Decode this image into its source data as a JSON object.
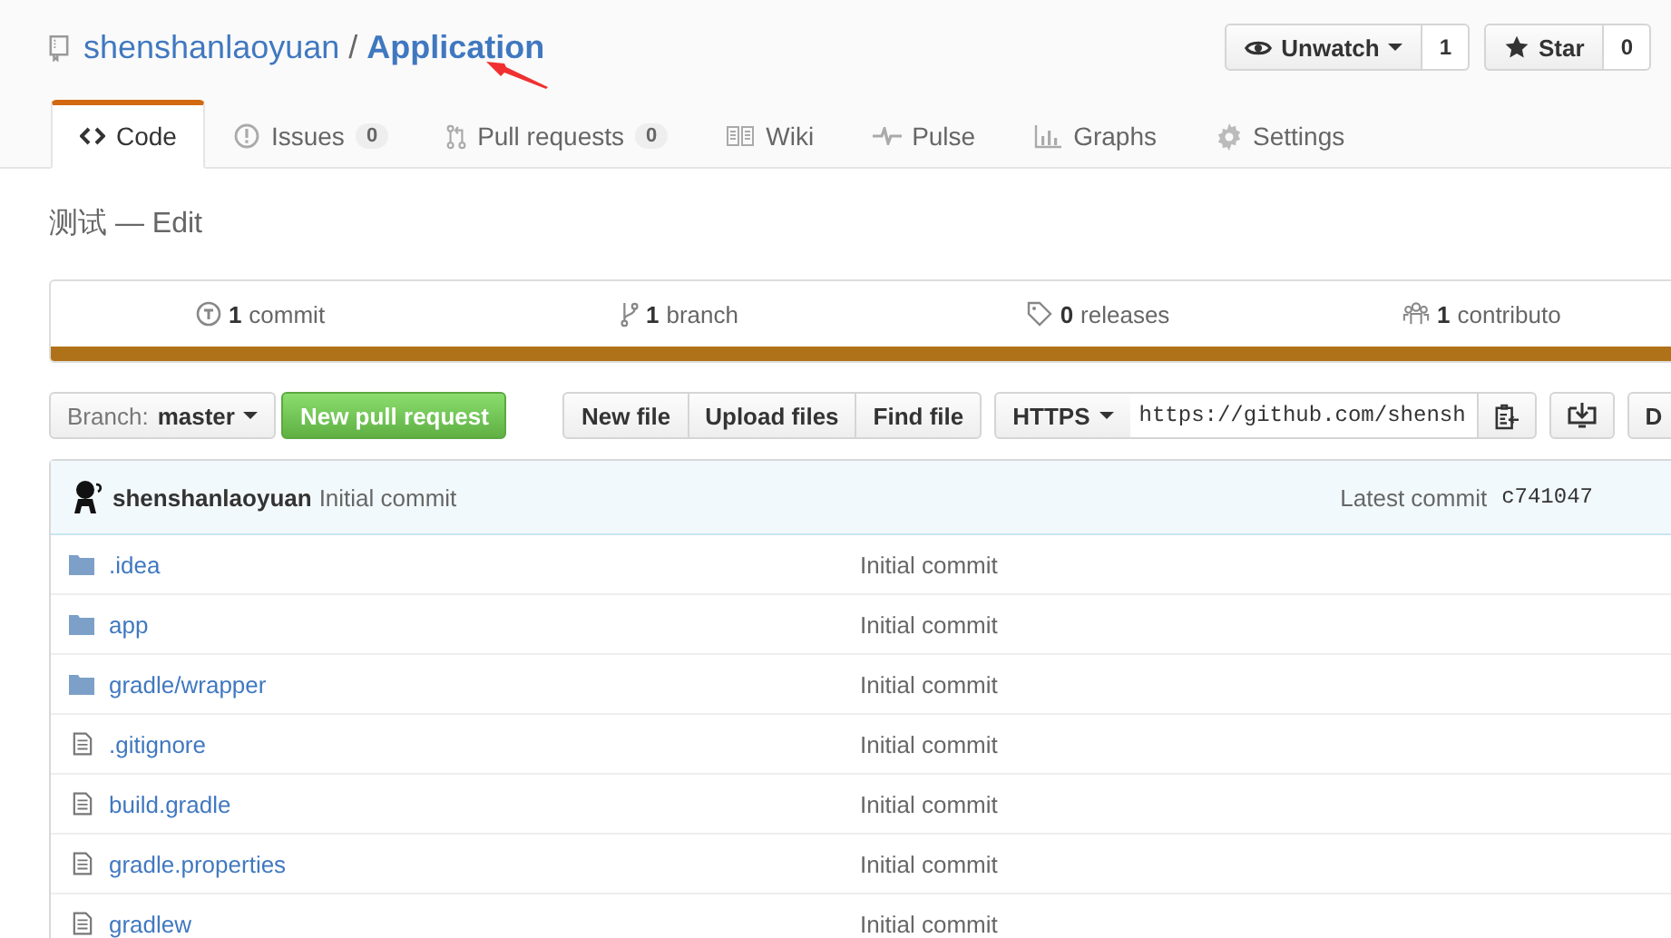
{
  "repo": {
    "owner": "shenshanlaoyuan",
    "separator": "/",
    "name": "Application"
  },
  "actions": [
    {
      "label": "Unwatch",
      "count": "1",
      "kind": "watch"
    },
    {
      "label": "Star",
      "count": "0",
      "kind": "star"
    }
  ],
  "tabs": [
    {
      "label": "Code",
      "selected": true,
      "kind": "code"
    },
    {
      "label": "Issues",
      "count": "0",
      "selected": false,
      "kind": "issues"
    },
    {
      "label": "Pull requests",
      "count": "0",
      "selected": false,
      "kind": "pulls"
    },
    {
      "label": "Wiki",
      "selected": false,
      "kind": "wiki"
    },
    {
      "label": "Pulse",
      "selected": false,
      "kind": "pulse"
    },
    {
      "label": "Graphs",
      "selected": false,
      "kind": "graphs"
    },
    {
      "label": "Settings",
      "selected": false,
      "kind": "settings"
    }
  ],
  "page_title": "测试 — Edit",
  "summary": [
    {
      "number": "1",
      "label": "commit",
      "kind": "commits"
    },
    {
      "number": "1",
      "label": "branch",
      "kind": "branches"
    },
    {
      "number": "0",
      "label": "releases",
      "kind": "releases"
    },
    {
      "number": "1",
      "label": "contributo",
      "kind": "contributors"
    }
  ],
  "toolbar": {
    "branch_label": "Branch:",
    "branch": "master",
    "new_pull_request": "New pull request",
    "file_buttons": [
      "New file",
      "Upload files",
      "Find file"
    ],
    "protocol": "HTTPS",
    "clone_url": "https://github.com/shensh",
    "download_button": "D"
  },
  "commit": {
    "author": "shenshanlaoyuan",
    "message": "Initial commit",
    "latest_label": "Latest commit",
    "sha": "c741047"
  },
  "files": [
    {
      "name": ".idea",
      "kind": "folder",
      "message": "Initial commit"
    },
    {
      "name": "app",
      "kind": "folder",
      "message": "Initial commit"
    },
    {
      "name": "gradle/wrapper",
      "kind": "folder",
      "message": "Initial commit"
    },
    {
      "name": ".gitignore",
      "kind": "file",
      "message": "Initial commit"
    },
    {
      "name": "build.gradle",
      "kind": "file",
      "message": "Initial commit"
    },
    {
      "name": "gradle.properties",
      "kind": "file",
      "message": "Initial commit"
    },
    {
      "name": "gradlew",
      "kind": "file",
      "message": "Initial commit"
    }
  ]
}
